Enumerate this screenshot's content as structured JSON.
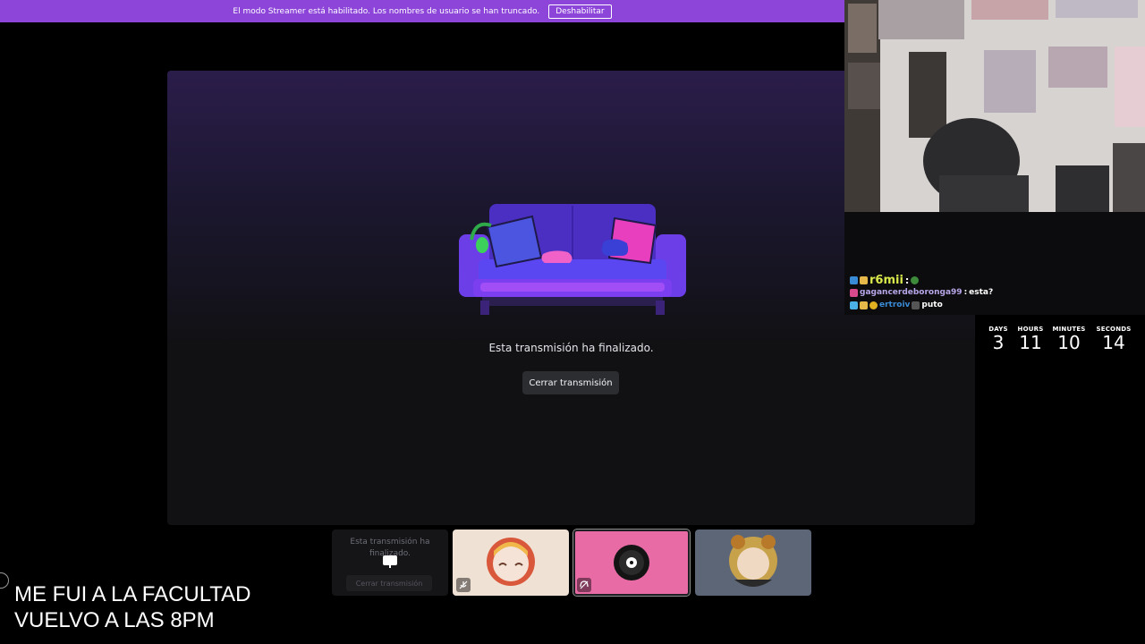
{
  "banner": {
    "message": "El modo Streamer está habilitado. Los nombres de usuario se han truncado.",
    "disable_label": "Deshabilitar",
    "color": "#8c44d9"
  },
  "stage": {
    "ended_message": "Esta transmisión ha finalizado.",
    "close_label": "Cerrar transmisión"
  },
  "chat": {
    "messages": [
      {
        "user": "r6mii",
        "separator": ":",
        "text": "",
        "user_color": "#d9e84a"
      },
      {
        "user": "gagancerdeboronga99",
        "separator": ":",
        "text": "esta?",
        "user_color": "#b7a6e8"
      },
      {
        "user": "ertroiv",
        "separator": "",
        "text": "puto",
        "user_color": "#3a8bd6"
      }
    ]
  },
  "countdown": {
    "units": [
      {
        "label": "DAYS",
        "value": "3"
      },
      {
        "label": "HOURS",
        "value": "11"
      },
      {
        "label": "MINUTES",
        "value": "10"
      },
      {
        "label": "SECONDS",
        "value": "14"
      }
    ]
  },
  "tiles": {
    "screen_share": {
      "ended_message": "Esta transmisión ha finalizado.",
      "close_label": "Cerrar transmisión"
    }
  },
  "overlay": {
    "line1": "ME FUI A LA FACULTAD",
    "line2": "VUELVO A LAS 8PM"
  }
}
